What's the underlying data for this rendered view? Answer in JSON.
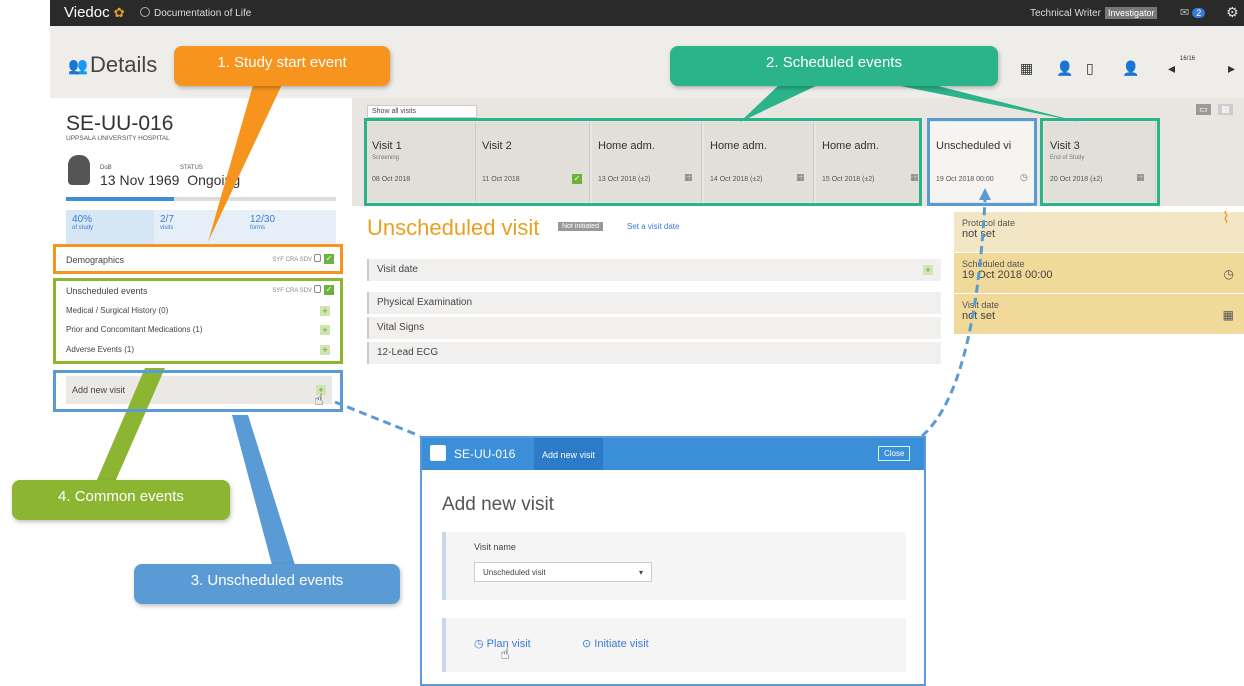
{
  "topbar": {
    "logo": "Viedoc",
    "study": "Documentation of Life",
    "user": "Technical Writer",
    "role": "Investigator",
    "mail_count": "2"
  },
  "header": {
    "title": "Details",
    "subject_counter": "16/16"
  },
  "subject": {
    "id": "SE-UU-016",
    "site": "UPPSALA UNIVERSITY HOSPITAL",
    "dob_label": "DoB",
    "status_label": "STATUS",
    "dob_value": "13 Nov 1969",
    "status_value": "Ongoing",
    "progress": 0.4,
    "stats": [
      {
        "value": "40%",
        "label": "of study"
      },
      {
        "value": "2/7",
        "label": "visits"
      },
      {
        "value": "12/30",
        "label": "forms"
      }
    ]
  },
  "left_events": {
    "demographics": "Demographics",
    "unscheduled_events": "Unscheduled events",
    "items": [
      "Medical / Surgical History (0)",
      "Prior and Concomitant Medications (1)",
      "Adverse Events (1)"
    ],
    "add_new_visit": "Add new visit",
    "flags": "SYF CRA SDV"
  },
  "visits": {
    "filter": "Show all visits",
    "tabs": [
      {
        "name": "Visit 1",
        "sub": "Screening",
        "date": "08 Oct 2018"
      },
      {
        "name": "Visit 2",
        "sub": "",
        "date": "11 Oct 2018"
      },
      {
        "name": "Home adm.",
        "sub": "",
        "date": "13 Oct 2018 (±2)"
      },
      {
        "name": "Home adm.",
        "sub": "",
        "date": "14 Oct 2018 (±2)"
      },
      {
        "name": "Home adm.",
        "sub": "",
        "date": "15 Oct 2018 (±2)"
      },
      {
        "name": "Unscheduled vi",
        "sub": "",
        "date": "19 Oct 2018 00:00"
      },
      {
        "name": "Visit 3",
        "sub": "End of Study",
        "date": "20 Oct 2018 (±2)"
      }
    ]
  },
  "main": {
    "title": "Unscheduled visit",
    "badge": "Not initiated",
    "set_date": "Set a visit date",
    "rows": [
      "Visit date",
      "Physical Examination",
      "Vital Signs",
      "12-Lead ECG"
    ],
    "dates": [
      {
        "label": "Protocol date",
        "value": "not set"
      },
      {
        "label": "Scheduled date",
        "value": "19 Oct 2018 00:00"
      },
      {
        "label": "Visit date",
        "value": "not set"
      }
    ]
  },
  "callouts": {
    "c1": "1. Study start event",
    "c2": "2. Scheduled events",
    "c3": "3. Unscheduled events",
    "c4": "4. Common events"
  },
  "dialog": {
    "subject": "SE-UU-016",
    "tab": "Add new visit",
    "close": "Close",
    "title": "Add new visit",
    "visit_name_label": "Visit name",
    "visit_name_value": "Unscheduled visit",
    "plan": "Plan visit",
    "initiate": "Initiate visit"
  },
  "colors": {
    "orange": "#f7941d",
    "green": "#8cb532",
    "teal": "#2bb38a",
    "blue": "#5b9bd5"
  }
}
